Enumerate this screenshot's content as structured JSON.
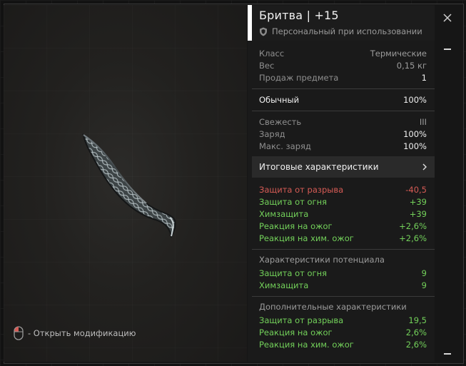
{
  "item": {
    "title": "Бритва | +15",
    "binding": "Персональный при использовании"
  },
  "hint": {
    "text": "- Открыть модификацию"
  },
  "basic": [
    {
      "label": "Класс",
      "value": "Термические"
    },
    {
      "label": "Вес",
      "value": "0,15 кг"
    },
    {
      "label": "Продаж предмета",
      "value": "1"
    }
  ],
  "rarity": {
    "label": "Обычный",
    "value": "100%"
  },
  "state": [
    {
      "label": "Свежесть",
      "value": "III"
    },
    {
      "label": "Заряд",
      "value": "100%"
    },
    {
      "label": "Макс. заряд",
      "value": "100%"
    }
  ],
  "final_button": {
    "label": "Итоговые характеристики"
  },
  "final_stats": [
    {
      "label": "Защита от разрыва",
      "value": "-40,5",
      "tone": "red"
    },
    {
      "label": "Защита от огня",
      "value": "+39",
      "tone": "green"
    },
    {
      "label": "Химзащита",
      "value": "+39",
      "tone": "green"
    },
    {
      "label": "Реакция на ожог",
      "value": "+2,6%",
      "tone": "green"
    },
    {
      "label": "Реакция на хим. ожог",
      "value": "+2,6%",
      "tone": "green"
    }
  ],
  "potential": {
    "header": "Характеристики потенциала",
    "rows": [
      {
        "label": "Защита от огня",
        "value": "9"
      },
      {
        "label": "Химзащита",
        "value": "9"
      }
    ]
  },
  "additional": {
    "header": "Дополнительные характеристики",
    "rows": [
      {
        "label": "Защита от разрыва",
        "value": "19,5"
      },
      {
        "label": "Реакция на ожог",
        "value": "2,6%"
      },
      {
        "label": "Реакция на хим. ожог",
        "value": "2,6%"
      }
    ]
  },
  "colors": {
    "positive": "#73d15a",
    "negative": "#d65b55",
    "accent": "#ffffff"
  },
  "icons": [
    "close-icon",
    "shield-icon",
    "mouse-icon",
    "chevron-right-icon"
  ]
}
